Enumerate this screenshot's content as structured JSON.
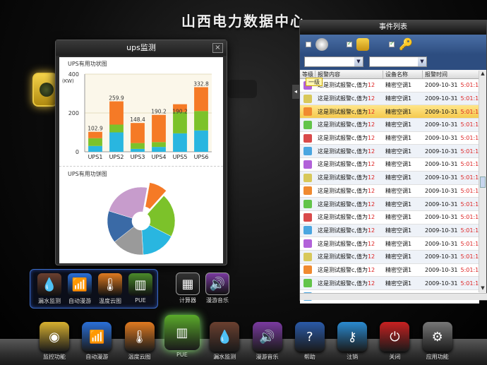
{
  "page_title": "山西电力数据中心",
  "ups_window": {
    "title": "ups监测",
    "close": "×",
    "bar_chart_title": "UPS有用功状图",
    "pie_chart_title": "UPS有用功饼图"
  },
  "chart_data": [
    {
      "type": "bar",
      "stacked": true,
      "categories": [
        "UPS1",
        "UPS2",
        "UPS3",
        "UPS4",
        "UPS5",
        "UPS6"
      ],
      "totals": [
        102.9,
        259.9,
        148.4,
        190.2,
        190.2,
        332.8
      ],
      "series": [
        {
          "values": [
            30,
            100,
            15,
            25,
            95,
            110
          ],
          "color": "#29b6e0"
        },
        {
          "values": [
            40,
            40,
            30,
            25,
            110,
            100
          ],
          "color": "#7cc22a"
        },
        {
          "values": [
            32.9,
            119.9,
            103.4,
            140.2,
            40,
            122.8
          ],
          "color": "#f57a26"
        }
      ],
      "title": "UPS有用功状图",
      "ylabel": "(KW)",
      "ylim": [
        0,
        400
      ],
      "yticks": [
        0,
        200,
        400
      ],
      "grid": true
    },
    {
      "type": "pie",
      "title": "UPS有用功饼图",
      "donut": true,
      "values": [
        8,
        19,
        15,
        14,
        14,
        21
      ],
      "colors": [
        "#f57a26",
        "#7cc22a",
        "#29b6e0",
        "#9a9a9a",
        "#3a6aa6",
        "#c79ccc"
      ],
      "exploded_index": 0
    }
  ],
  "events": {
    "title": "事件列表",
    "headers": [
      "等级",
      "报警内容",
      "设备名称",
      "报警时间"
    ],
    "tooltip": "一级",
    "rows": [
      {
        "color": "#b262d9",
        "content": "这是测试报警c,值为",
        "value": "12",
        "device": "精密空调1",
        "date": "2009-10-31",
        "time": "5:01:10"
      },
      {
        "color": "#d8c85a",
        "content": "这是测试报警c,值为",
        "value": "12",
        "device": "精密空调1",
        "date": "2009-10-31",
        "time": "5:01:10"
      },
      {
        "color": "#f08a30",
        "content": "这是测试报警c,值为",
        "value": "12",
        "device": "精密空调1",
        "date": "2009-10-31",
        "time": "5:01:10"
      },
      {
        "color": "#62c44a",
        "content": "这是测试报警c,值为",
        "value": "12",
        "device": "精密空调1",
        "date": "2009-10-31",
        "time": "5:01:10"
      },
      {
        "color": "#d94a4a",
        "content": "这是测试报警c,值为",
        "value": "12",
        "device": "精密空调1",
        "date": "2009-10-31",
        "time": "5:01:10"
      },
      {
        "color": "#4aa6e0",
        "content": "这是测试报警c,值为",
        "value": "12",
        "device": "精密空调1",
        "date": "2009-10-31",
        "time": "5:01:10"
      },
      {
        "color": "#b262d9",
        "content": "这是测试报警c,值为",
        "value": "12",
        "device": "精密空调1",
        "date": "2009-10-31",
        "time": "5:01:10"
      },
      {
        "color": "#d8c85a",
        "content": "这是测试报警c,值为",
        "value": "12",
        "device": "精密空调1",
        "date": "2009-10-31",
        "time": "5:01:10"
      },
      {
        "color": "#f08a30",
        "content": "这是测试报警c,值为",
        "value": "12",
        "device": "精密空调1",
        "date": "2009-10-31",
        "time": "5:01:10"
      },
      {
        "color": "#62c44a",
        "content": "这是测试报警c,值为",
        "value": "12",
        "device": "精密空调1",
        "date": "2009-10-31",
        "time": "5:01:10"
      },
      {
        "color": "#d94a4a",
        "content": "这是测试报警c,值为",
        "value": "12",
        "device": "精密空调1",
        "date": "2009-10-31",
        "time": "5:01:10"
      },
      {
        "color": "#4aa6e0",
        "content": "这是测试报警c,值为",
        "value": "12",
        "device": "精密空调1",
        "date": "2009-10-31",
        "time": "5:01:10"
      },
      {
        "color": "#b262d9",
        "content": "这是测试报警c,值为",
        "value": "12",
        "device": "精密空调1",
        "date": "2009-10-31",
        "time": "5:01:10"
      },
      {
        "color": "#d8c85a",
        "content": "这是测试报警c,值为",
        "value": "12",
        "device": "精密空调1",
        "date": "2009-10-31",
        "time": "5:01:10"
      },
      {
        "color": "#f08a30",
        "content": "这是测试报警c,值为",
        "value": "12",
        "device": "精密空调1",
        "date": "2009-10-31",
        "time": "5:01:10"
      },
      {
        "color": "#62c44a",
        "content": "这是测试报警c,值为",
        "value": "12",
        "device": "精密空调1",
        "date": "2009-10-31",
        "time": "5:01:10"
      },
      {
        "color": "#4aa6e0",
        "content": "这是测试报警c,值为",
        "value": "12",
        "device": "精密空调1",
        "date": "2009-10-31",
        "time": "5:01:10"
      }
    ]
  },
  "sub_icons": [
    {
      "label": "漏水监测",
      "icon": "water-drop-icon",
      "color": "#6b4030"
    },
    {
      "label": "自动漫游",
      "icon": "tower-signal-icon",
      "color": "#2a6fd8"
    },
    {
      "label": "温度云图",
      "icon": "thermometer-icon",
      "color": "#e07a20"
    },
    {
      "label": "PUE",
      "icon": "bar-chart-icon",
      "color": "#4a8a2a"
    }
  ],
  "extra_icons": [
    {
      "label": "计算器",
      "icon": "calculator-icon",
      "color": "#333333"
    },
    {
      "label": "漫游音乐",
      "icon": "speaker-icon",
      "color": "#7a3aa0"
    }
  ],
  "dock": [
    {
      "label": "监控功能",
      "icon": "radar-icon",
      "color": "#d8b030"
    },
    {
      "label": "自动漫游",
      "icon": "tower-signal-icon",
      "color": "#2a6fd8"
    },
    {
      "label": "温度云图",
      "icon": "thermometer-icon",
      "color": "#e07a20"
    },
    {
      "label": "PUE",
      "icon": "bar-chart-icon",
      "color": "#5aaa2a"
    },
    {
      "label": "漏水监测",
      "icon": "water-drop-icon",
      "color": "#6b4030"
    },
    {
      "label": "漫游音乐",
      "icon": "speaker-icon",
      "color": "#7a3aa0"
    },
    {
      "label": "帮助",
      "icon": "help-icon",
      "color": "#2a5aa8"
    },
    {
      "label": "注销",
      "icon": "key-icon",
      "color": "#2a8ad0"
    },
    {
      "label": "关闭",
      "icon": "power-icon",
      "color": "#c82020"
    },
    {
      "label": "应用功能",
      "icon": "gear-icon",
      "color": "#777777"
    }
  ]
}
